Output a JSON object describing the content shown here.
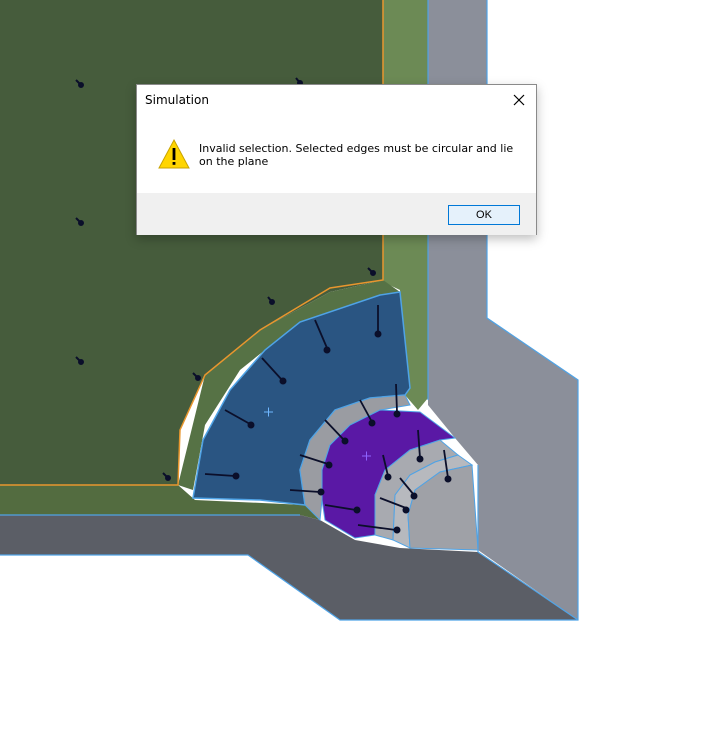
{
  "dialog": {
    "title": "Simulation",
    "message": "Invalid selection. Selected edges must be circular and lie on the plane",
    "ok_label": "OK",
    "icon": "warning-icon"
  },
  "viewport": {
    "description_icons": [
      "load-arrow-icon",
      "center-mark-icon"
    ]
  },
  "colors": {
    "green_face": "#465c3c",
    "blue_face": "#2a5582",
    "purple_face": "#5a18a5",
    "gray_face": "#8c909a",
    "dark_gray_face": "#5b5e66",
    "edge_highlight": "#4fa3e6",
    "orange_edge": "#e8962e"
  }
}
